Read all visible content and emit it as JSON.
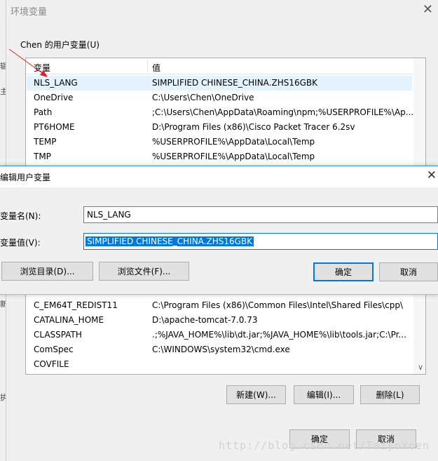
{
  "outer_window": {
    "title": "环境变量",
    "close_glyph": "✕",
    "left_fragments": [
      "辑",
      "主",
      "新",
      "执"
    ]
  },
  "user_vars": {
    "group_title": "Chen 的用户变量(U)",
    "columns": [
      "变量",
      "值"
    ],
    "rows_top": [
      {
        "name": "NLS_LANG",
        "value": "SIMPLIFIED CHINESE_CHINA.ZHS16GBK"
      },
      {
        "name": "OneDrive",
        "value": "C:\\Users\\Chen\\OneDrive"
      },
      {
        "name": "Path",
        "value": ";C:\\Users\\Chen\\AppData\\Roaming\\npm;%USERPROFILE%\\Ap..."
      },
      {
        "name": "PT6HOME",
        "value": "D:\\Program Files (x86)\\Cisco Packet Tracer 6.2sv"
      },
      {
        "name": "TEMP",
        "value": "%USERPROFILE%\\AppData\\Local\\Temp"
      },
      {
        "name": "TMP",
        "value": "%USERPROFILE%\\AppData\\Local\\Temp"
      }
    ],
    "rows_bottom": [
      {
        "name": "C_EM64T_REDIST11",
        "value": "C:\\Program Files (x86)\\Common Files\\Intel\\Shared Files\\cpp\\"
      },
      {
        "name": "CATALINA_HOME",
        "value": "D:\\apache-tomcat-7.0.73"
      },
      {
        "name": "CLASSPATH",
        "value": ".;%JAVA_HOME%\\lib\\dt.jar;%JAVA_HOME%\\lib\\tools.jar;C:\\Pr..."
      },
      {
        "name": "ComSpec",
        "value": "C:\\WINDOWS\\system32\\cmd.exe"
      },
      {
        "name": "COVFILE",
        "value": ""
      }
    ],
    "scroll_down_glyph": "∨"
  },
  "buttons": {
    "new": "新建(W)...",
    "edit": "编辑(I)...",
    "delete": "删除(L)",
    "ok": "确定",
    "cancel": "取消"
  },
  "edit_dialog": {
    "title": "编辑用户变量",
    "close_glyph": "✕",
    "name_label": "变量名(N):",
    "name_value": "NLS_LANG",
    "value_label": "变量值(V):",
    "value_value": "SIMPLIFIED CHINESE_CHINA.ZHS16GBK",
    "browse_dir": "浏览目录(D)...",
    "browse_file": "浏览文件(F)...",
    "ok": "确定",
    "cancel": "取消"
  },
  "watermark": "http://blog.csdn.net/TaiyoYoen",
  "colors": {
    "accent": "#0078d7",
    "selection_row": "#e5f3ff",
    "annotation_arrow": "#e02020"
  }
}
